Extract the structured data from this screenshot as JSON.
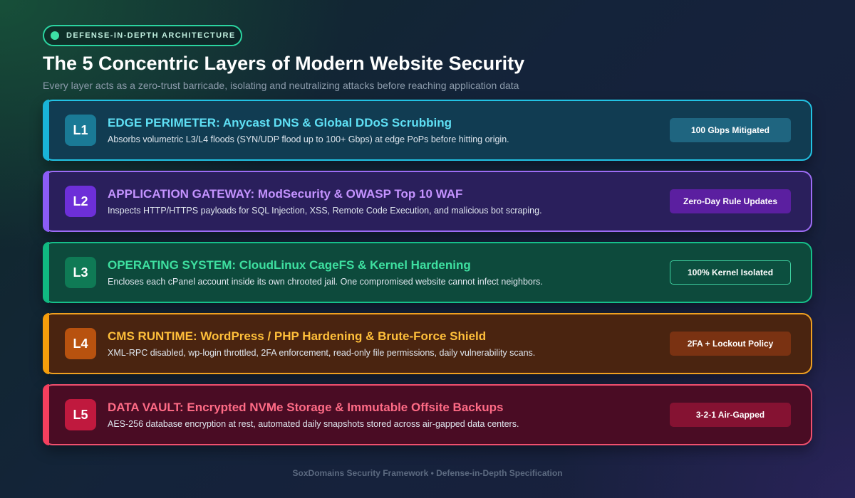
{
  "badge": {
    "label": "DEFENSE-IN-DEPTH ARCHITECTURE"
  },
  "title": "The 5 Concentric Layers of Modern Website Security",
  "subtitle": "Every layer acts as a zero-trust barricade, isolating and neutralizing attacks before reaching application data",
  "layers": [
    {
      "tag": "L1",
      "heading": "EDGE PERIMETER: Anycast DNS & Global DDoS Scrubbing",
      "description": "Absorbs volumetric L3/L4 floods (SYN/UDP flood up to 100+ Gbps) at edge PoPs before hitting origin.",
      "status": "100 Gbps Mitigated",
      "colors": {
        "accent": "#19b4d8",
        "border": "#22c3e4",
        "bg": "#113c52",
        "box": "#1a7a96",
        "heading": "#5fe0f5",
        "pill": "#1f6580",
        "pill_border": "#1f6580"
      }
    },
    {
      "tag": "L2",
      "heading": "APPLICATION GATEWAY: ModSecurity & OWASP Top 10 WAF",
      "description": "Inspects HTTP/HTTPS payloads for SQL Injection, XSS, Remote Code Execution, and malicious bot scraping.",
      "status": "Zero-Day Rule Updates",
      "colors": {
        "accent": "#8b5cf6",
        "border": "#9d6cf5",
        "bg": "#2a1f5c",
        "box": "#6d2fd8",
        "heading": "#c493ff",
        "pill": "#5b1fa0",
        "pill_border": "#5b1fa0"
      }
    },
    {
      "tag": "L3",
      "heading": "OPERATING SYSTEM: CloudLinux CageFS & Kernel Hardening",
      "description": "Encloses each cPanel account inside its own chrooted jail. One compromised website cannot infect neighbors.",
      "status": "100% Kernel Isolated",
      "colors": {
        "accent": "#10b981",
        "border": "#16c08a",
        "bg": "#0d4a3c",
        "box": "#0f7a55",
        "heading": "#3ee0a0",
        "pill": "#0c4f3f",
        "pill_border": "#3ed0a0"
      }
    },
    {
      "tag": "L4",
      "heading": "CMS RUNTIME: WordPress / PHP Hardening & Brute-Force Shield",
      "description": "XML-RPC disabled, wp-login throttled, 2FA enforcement, read-only file permissions, daily vulnerability scans.",
      "status": "2FA + Lockout Policy",
      "colors": {
        "accent": "#f59e0b",
        "border": "#f0a020",
        "bg": "#4a2410",
        "box": "#b8520f",
        "heading": "#ffbf3a",
        "pill": "#7a3212",
        "pill_border": "#7a3212"
      }
    },
    {
      "tag": "L5",
      "heading": "DATA VAULT: Encrypted NVMe Storage & Immutable Offsite Backups",
      "description": "AES-256 database encryption at rest, automated daily snapshots stored across air-gapped data centers.",
      "status": "3-2-1 Air-Gapped",
      "colors": {
        "accent": "#f43f5e",
        "border": "#f0506e",
        "bg": "#4a0c24",
        "box": "#c0193e",
        "heading": "#ff6b86",
        "pill": "#851232",
        "pill_border": "#851232"
      }
    }
  ],
  "footer": "SoxDomains Security Framework • Defense-in-Depth Specification"
}
